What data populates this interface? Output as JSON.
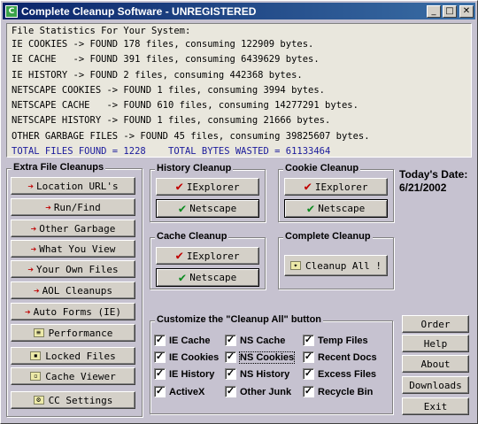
{
  "window": {
    "title": "Complete Cleanup Software - UNREGISTERED",
    "icon": "app-icon",
    "controls": [
      "minimize",
      "maximize",
      "close"
    ]
  },
  "stats": {
    "heading": "File Statistics For Your System:",
    "lines": [
      "IE COOKIES -> FOUND 178 files, consuming 122909 bytes.",
      "IE CACHE   -> FOUND 391 files, consuming 6439629 bytes.",
      "IE HISTORY -> FOUND 2 files, consuming 442368 bytes.",
      "NETSCAPE COOKIES -> FOUND 1 files, consuming 3994 bytes.",
      "NETSCAPE CACHE   -> FOUND 610 files, consuming 14277291 bytes.",
      "NETSCAPE HISTORY -> FOUND 1 files, consuming 21666 bytes.",
      "OTHER GARBAGE FILES -> FOUND 45 files, consuming 39825607 bytes."
    ],
    "total": "TOTAL FILES FOUND = 1228    TOTAL BYTES WASTED = 61133464"
  },
  "extra": {
    "title": "Extra File Cleanups",
    "buttons": [
      "Location URL's",
      "Run/Find",
      "Other Garbage",
      "What You View",
      "Your Own Files",
      "AOL Cleanups",
      "Auto Forms (IE)",
      "Performance",
      "Locked Files",
      "Cache Viewer",
      "CC Settings"
    ]
  },
  "history": {
    "title": "History Cleanup",
    "ie": "IExplorer",
    "ns": "Netscape"
  },
  "cookie": {
    "title": "Cookie Cleanup",
    "ie": "IExplorer",
    "ns": "Netscape"
  },
  "cache": {
    "title": "Cache Cleanup",
    "ie": "IExplorer",
    "ns": "Netscape"
  },
  "complete": {
    "title": "Complete Cleanup",
    "button": "Cleanup All !"
  },
  "date": {
    "label": "Today's Date:",
    "value": "6/21/2002"
  },
  "customize": {
    "title": "Customize the \"Cleanup All\" button",
    "items": [
      {
        "label": "IE Cache",
        "checked": true
      },
      {
        "label": "NS Cache",
        "checked": true
      },
      {
        "label": "Temp Files",
        "checked": true
      },
      {
        "label": "IE Cookies",
        "checked": true
      },
      {
        "label": "NS Cookies",
        "checked": true
      },
      {
        "label": "Recent Docs",
        "checked": true
      },
      {
        "label": "IE History",
        "checked": true
      },
      {
        "label": "NS History",
        "checked": true
      },
      {
        "label": "Excess Files",
        "checked": true
      },
      {
        "label": "ActiveX",
        "checked": true
      },
      {
        "label": "Other Junk",
        "checked": true
      },
      {
        "label": "Recycle Bin",
        "checked": true
      }
    ]
  },
  "side": {
    "buttons": [
      "Order",
      "Help",
      "About",
      "Downloads",
      "Exit"
    ]
  },
  "colors": {
    "titlebar": "#0a246a",
    "total_text": "#1a1a9c",
    "arrow": "#c00000",
    "check_green": "#0a8a1e"
  }
}
